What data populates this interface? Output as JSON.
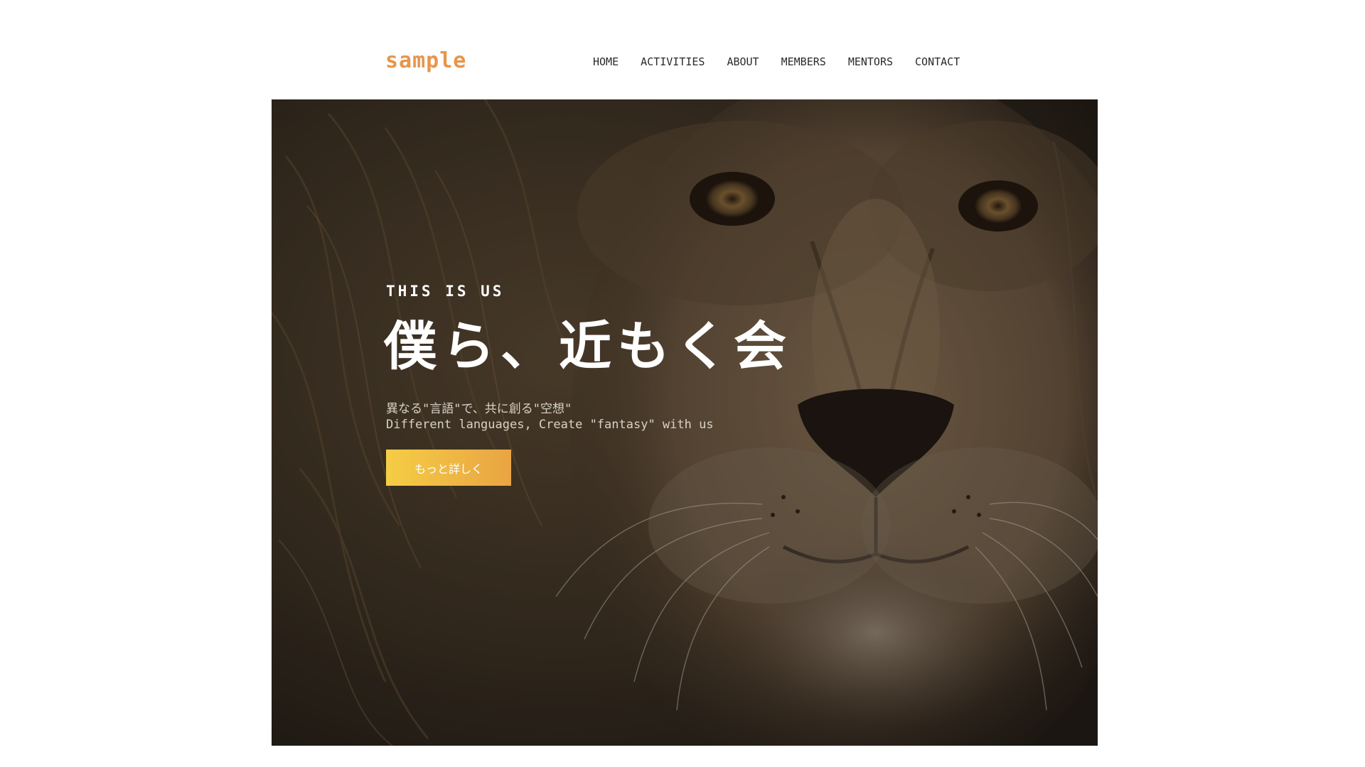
{
  "header": {
    "logo": "sample",
    "nav": [
      "HOME",
      "ACTIVITIES",
      "ABOUT",
      "MEMBERS",
      "MENTORS",
      "CONTACT"
    ]
  },
  "hero": {
    "eyebrow": "THIS IS US",
    "headline": "僕ら、近もく会",
    "subtitle_ja": "異なる\"言語\"で、共に創る\"空想\"",
    "subtitle_en": "Different languages, Create \"fantasy\" with us",
    "cta_label": "もっと詳しく",
    "image": "lion-face-photo"
  },
  "colors": {
    "logo": "#e8954a",
    "cta_start": "#f5cd45",
    "cta_end": "#e9a443"
  }
}
